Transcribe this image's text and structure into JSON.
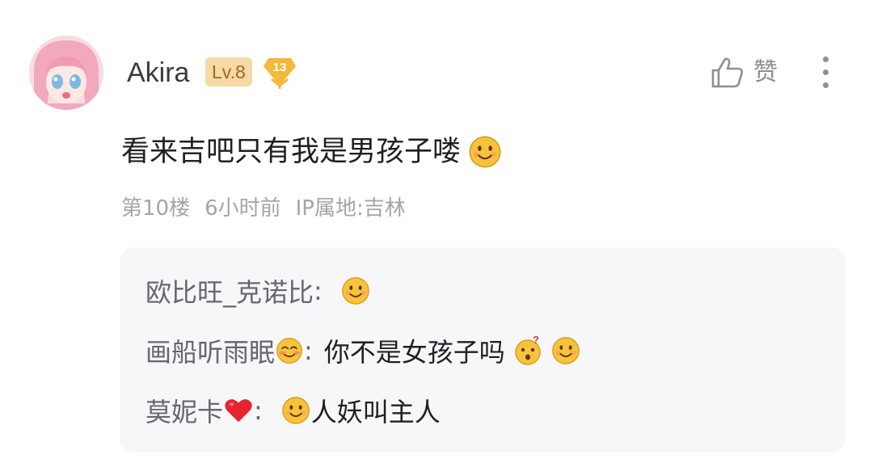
{
  "post": {
    "author": {
      "username": "Akira",
      "level_badge": "Lv.8",
      "fan_badge_level": "13",
      "avatar_icon": "anime-avatar"
    },
    "actions": {
      "like_label": "赞",
      "like_icon": "thumbs-up-icon",
      "more_icon": "more-vertical-icon"
    },
    "content": {
      "text": "看来吉吧只有我是男孩子喽",
      "trailing_emoji": "smile-emoji"
    },
    "meta": {
      "floor": "第10楼",
      "time": "6小时前",
      "ip_location": "IP属地:吉林"
    }
  },
  "replies": [
    {
      "name": "欧比旺_克诺比",
      "name_emoji": "",
      "colon": ":",
      "emojis_before": [],
      "text": "",
      "emojis_after": [
        "smile-emoji"
      ]
    },
    {
      "name": "画船听雨眠",
      "name_emoji": "blush-emoji",
      "colon": ":",
      "emojis_before": [],
      "text": "你不是女孩子吗",
      "emojis_after": [
        "surprised-emoji",
        "smile-emoji"
      ]
    },
    {
      "name": "莫妮卡",
      "name_emoji": "heart-emoji",
      "colon": ":",
      "emojis_before": [
        "smile-emoji"
      ],
      "text": "人妖叫主人",
      "emojis_after": []
    }
  ],
  "colors": {
    "primary_text": "#1f1f24",
    "secondary_text": "#a4a4ab",
    "level_badge_bg": "#f5d9a6",
    "level_badge_text": "#a2681c",
    "fan_badge_bg": "#f5b83a",
    "reply_box_bg": "#f7f7fa",
    "emoji_yellow": "#f7c33a"
  }
}
